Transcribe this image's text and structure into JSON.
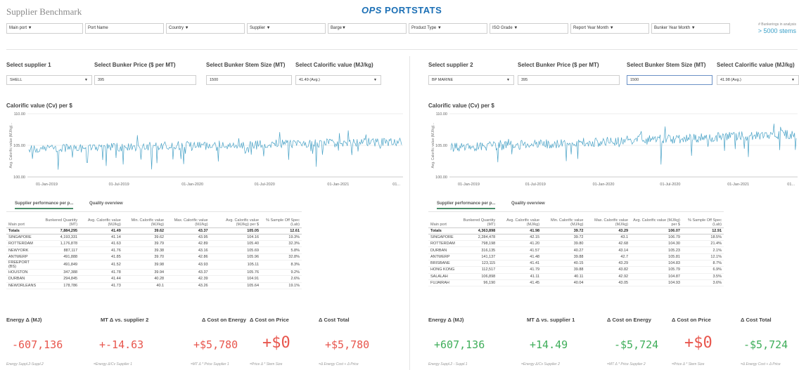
{
  "app_title": "Supplier Benchmark",
  "logo": {
    "ops": "OPS",
    "portstats": "PORTSTATS"
  },
  "filters": [
    {
      "label": "Main port ▼",
      "width": 109
    },
    {
      "label": "Port Name",
      "width": 112
    },
    {
      "label": "Country ▼",
      "width": 112
    },
    {
      "label": "Supplier ▼",
      "width": 112
    },
    {
      "label": "Barge▼",
      "width": 112
    },
    {
      "label": "Product Type ▼",
      "width": 112
    },
    {
      "label": "ISO Grade ▼",
      "width": 112
    },
    {
      "label": "Report Year Month ▼",
      "width": 112
    },
    {
      "label": "Bunker Year Month ▼",
      "width": 112
    }
  ],
  "stems_note": {
    "small": "# Bunkerings in analysis",
    "big": "> 5000 stems"
  },
  "left": {
    "select_supplier_label": "Select supplier 1",
    "supplier_value": "SHELL",
    "price_label": "Select Bunker Price ($ per MT)",
    "price_value": "395",
    "stem_label": "Select Bunker Stem Size (MT)",
    "stem_value": "1500",
    "cv_label": "Select Calorific value (MJ/kg)",
    "cv_value": "41.49 (Avg.)",
    "chart_title": "Calorific value (Cv) per $",
    "y_axis_label": "Avg. Calorific value (MJ/kg)...",
    "tabs": [
      "Supplier performance per p...",
      "Quality overview"
    ],
    "headers": [
      "Main port",
      "Bunkered Quantity (MT)",
      "Avg. Calorific value (MJ/kg)",
      "Min. Calorific value (MJ/kg)",
      "Max. Calorific value (MJ/kg)",
      "Avg. Calorific value (MJ/kg) per $",
      "% Sample Off Spec (Lab)"
    ],
    "totals": [
      "Totals",
      "7,884,295",
      "41.49",
      "39.62",
      "43.37",
      "105.05",
      "12.61"
    ],
    "rows": [
      [
        "SINGAPORE",
        "4,193,331",
        "41.14",
        "39.62",
        "43.95",
        "104.16",
        "19.3%"
      ],
      [
        "ROTTERDAM",
        "1,176,878",
        "41.63",
        "39.79",
        "42.89",
        "105.40",
        "32.3%"
      ],
      [
        "NEWYORK",
        "887,117",
        "41.76",
        "39.38",
        "43.16",
        "105.69",
        "5.8%"
      ],
      [
        "ANTWERP",
        "491,888",
        "41.85",
        "39.70",
        "42.86",
        "105.96",
        "32.8%"
      ],
      [
        "FREEPORT (BS)",
        "491,849",
        "41.52",
        "39.98",
        "43.93",
        "105.11",
        "8.3%"
      ],
      [
        "HOUSTON",
        "347,388",
        "41.78",
        "39.94",
        "43.37",
        "105.76",
        "9.2%"
      ],
      [
        "DURBAN",
        "294,845",
        "41.44",
        "40.28",
        "42.39",
        "104.91",
        "2.6%"
      ],
      [
        "NEWORLEANS",
        "178,786",
        "41.73",
        "40.1",
        "43.26",
        "105.64",
        "19.1%"
      ]
    ],
    "kpis": [
      {
        "title": "Energy Δ (MJ)",
        "value": "-607,136",
        "foot": "Energy Suppl.2-Suppl.2",
        "color": "red"
      },
      {
        "title": "MT Δ vs. supplier 2",
        "value": "+-14.63",
        "foot": "=Energy Δ/Cv Supplier 1",
        "color": "red"
      },
      {
        "title": "Δ Cost on Energy",
        "value": "+$5,780",
        "foot": "=MT Δ * Price Supplier 1",
        "color": "red"
      },
      {
        "title": "Δ Cost on Price",
        "value": "+$0",
        "foot": "=Price Δ * Stem Size",
        "color": "red",
        "big": true
      },
      {
        "title": "Δ Cost Total",
        "value": "+$5,780",
        "foot": "=Δ Energy Cost + Δ Price",
        "color": "red"
      }
    ]
  },
  "right": {
    "select_supplier_label": "Select supplier 2",
    "supplier_value": "BP MARINE",
    "price_label": "Select Bunker Price ($ per MT)",
    "price_value": "395",
    "stem_label": "Select Bunker Stem Size (MT)",
    "stem_value": "1500",
    "cv_label": "Select Calorific value (MJ/kg)",
    "cv_value": "41.98 (Avg.)",
    "chart_title": "Calorific value (Cv) per $",
    "y_axis_label": "Avg. Calorific value (MJ/kg)...",
    "tabs": [
      "Supplier performance per p...",
      "Quality overview"
    ],
    "headers": [
      "Main port",
      "Bunkered Quantity (MT)",
      "Avg. Calorific value (MJ/kg)",
      "Min. Calorific value (MJ/kg)",
      "Max. Calorific value (MJ/kg)",
      "Avg. Calorific value (MJ/kg) per $",
      "% Sample Off Spec (Lab)"
    ],
    "totals": [
      "Totals",
      "4,363,898",
      "41.98",
      "39.72",
      "43.29",
      "106.07",
      "12.91"
    ],
    "rows": [
      [
        "SINGAPORE",
        "2,284,478",
        "42.15",
        "39.72",
        "43.1",
        "106.79",
        "18.5%"
      ],
      [
        "ROTTERDAM",
        "798,198",
        "41.20",
        "39.80",
        "42.68",
        "104.30",
        "21.4%"
      ],
      [
        "DURBAN",
        "316,135",
        "41.57",
        "40.27",
        "43.14",
        "105.23",
        "2.1%"
      ],
      [
        "ANTWERP",
        "141,137",
        "41.48",
        "39.88",
        "42.7",
        "105.81",
        "12.1%"
      ],
      [
        "BRISBANE",
        "123,115",
        "41.41",
        "40.15",
        "43.29",
        "104.83",
        "8.7%"
      ],
      [
        "HONG KONG",
        "112,517",
        "41.79",
        "39.88",
        "43.82",
        "105.79",
        "6.9%"
      ],
      [
        "SALALAH",
        "106,898",
        "41.11",
        "40.11",
        "42.92",
        "104.87",
        "3.5%"
      ],
      [
        "FUJAIRAH",
        "96,190",
        "41.45",
        "40.04",
        "43.05",
        "104.93",
        "3.6%"
      ]
    ],
    "kpis": [
      {
        "title": "Energy Δ (MJ)",
        "value": "+607,136",
        "foot": "Energy Suppl.2 - Suppl.1",
        "color": "green"
      },
      {
        "title": "MT Δ vs. supplier 1",
        "value": "+14.49",
        "foot": "=Energy Δ/Cv Supplier 2",
        "color": "green"
      },
      {
        "title": "Δ Cost on Energy",
        "value": "-$5,724",
        "foot": "=MT Δ * Price Supplier 2",
        "color": "green"
      },
      {
        "title": "Δ Cost on Price",
        "value": "+$0",
        "foot": "=Price Δ * Stem Size",
        "color": "red",
        "big": true
      },
      {
        "title": "Δ Cost Total",
        "value": "-$5,724",
        "foot": "=Δ Energy Cost + Δ Price",
        "color": "green"
      }
    ]
  },
  "chart_data": [
    {
      "type": "line",
      "title": "Calorific value (Cv) per $",
      "ylabel": "Avg. Calorific value (MJ/kg)...",
      "ylim": [
        100,
        110
      ],
      "yticks": [
        "110.00",
        "105.00",
        "100.00"
      ],
      "xticks": [
        "01-Jan-2019",
        "01-Jul-2019",
        "01-Jan-2020",
        "01-Jul-2020",
        "01-Jan-2021",
        "01..."
      ],
      "series": [
        {
          "baseline_start": 104.5,
          "baseline_end": 105.6,
          "noise": 1.4
        }
      ]
    },
    {
      "type": "line",
      "title": "Calorific value (Cv) per $",
      "ylabel": "Avg. Calorific value (MJ/kg)...",
      "ylim": [
        100,
        110
      ],
      "yticks": [
        "110.00",
        "105.00",
        "100.00"
      ],
      "xticks": [
        "01-Jan-2019",
        "01-Jul-2019",
        "01-Jan-2020",
        "01-Jul-2020",
        "01-Jan-2021",
        "01..."
      ],
      "series": [
        {
          "baseline_start": 104.6,
          "baseline_end": 106.8,
          "noise": 1.5
        }
      ]
    }
  ],
  "colors": {
    "accent": "#4aa3c7",
    "red": "#e8564d",
    "green": "#3fae5a",
    "logo": "#1b6fb5"
  }
}
